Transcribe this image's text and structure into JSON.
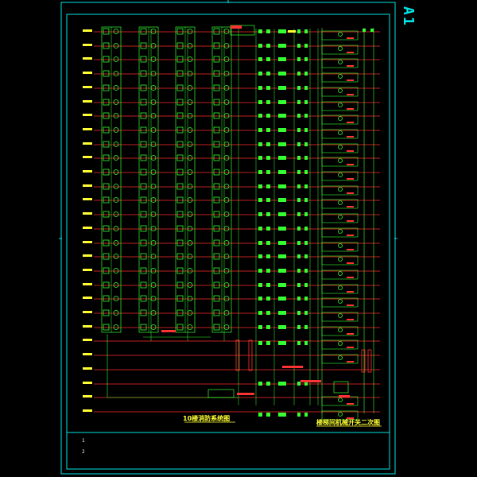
{
  "sheet_mark": "A1",
  "caption_left": "10楼消防系统图",
  "caption_right": "楼梯间机械开关二次图",
  "title_block_marks": [
    "1",
    "2"
  ],
  "floors": {
    "count": 28
  },
  "colors": {
    "frame": "#00e5e5",
    "wire": "#ff2a2a",
    "device": "#33ff33",
    "caption": "#ffff33",
    "annotation": "#ff3333",
    "marker": "#ffff33"
  }
}
